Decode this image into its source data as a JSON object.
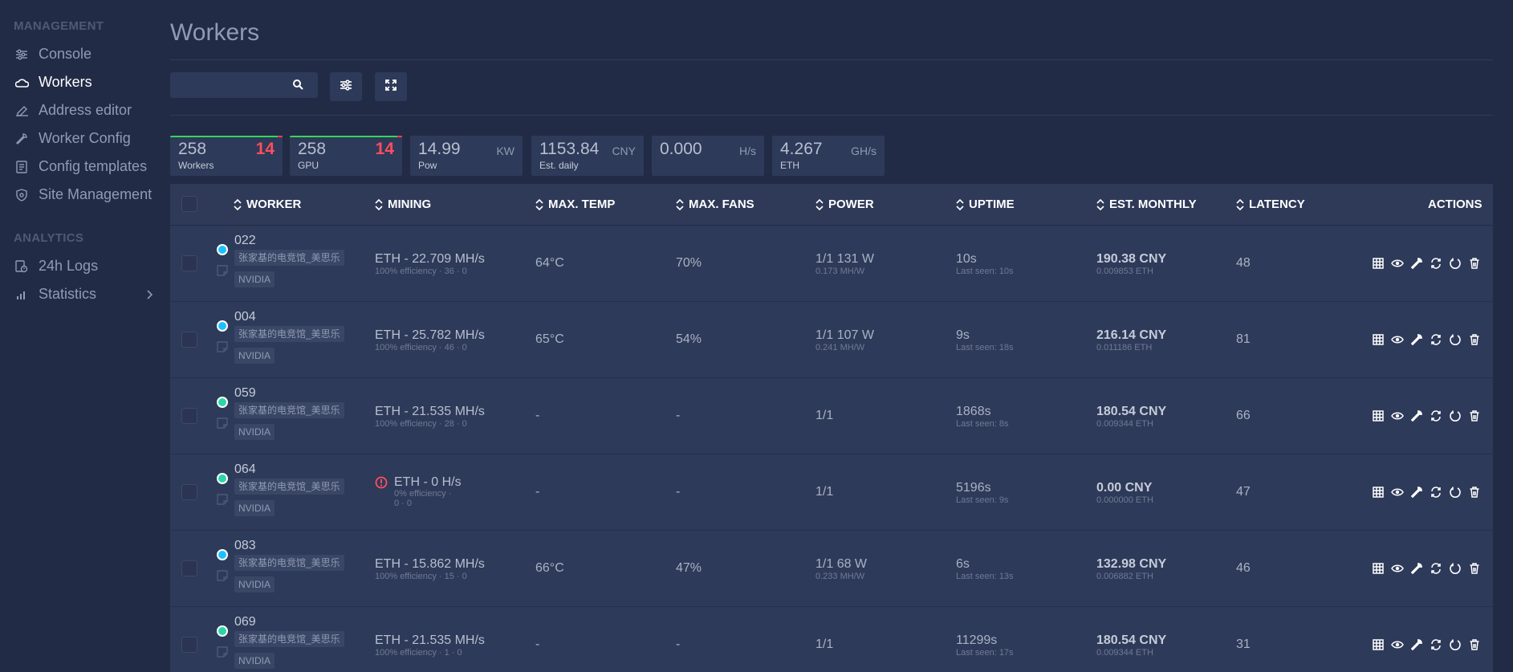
{
  "sidebar": {
    "management_title": "MANAGEMENT",
    "management_items": [
      {
        "label": "Console",
        "icon": "sliders-icon"
      },
      {
        "label": "Workers",
        "icon": "cloud-icon",
        "active": true
      },
      {
        "label": "Address editor",
        "icon": "edit-icon"
      },
      {
        "label": "Worker Config",
        "icon": "wrench-icon"
      },
      {
        "label": "Config templates",
        "icon": "document-icon"
      },
      {
        "label": "Site Management",
        "icon": "shield-icon"
      }
    ],
    "analytics_title": "ANALYTICS",
    "analytics_items": [
      {
        "label": "24h Logs",
        "icon": "log-icon"
      },
      {
        "label": "Statistics",
        "icon": "bar-chart-icon"
      }
    ]
  },
  "page": {
    "title": "Workers",
    "search_placeholder": ""
  },
  "stats": [
    {
      "value": "258",
      "label": "Workers",
      "bad": "14"
    },
    {
      "value": "258",
      "label": "GPU",
      "bad": "14"
    },
    {
      "value": "14.99",
      "label": "Pow",
      "unit": "KW"
    },
    {
      "value": "1153.84",
      "label": "Est. daily",
      "unit": "CNY"
    },
    {
      "value": "0.000",
      "label": "",
      "unit": "H/s"
    },
    {
      "value": "4.267",
      "label": "ETH",
      "unit": "GH/s"
    }
  ],
  "table": {
    "headers": {
      "worker": "WORKER",
      "mining": "MINING",
      "max_temp": "MAX. TEMP",
      "max_fans": "MAX. FANS",
      "power": "POWER",
      "uptime": "UPTIME",
      "est_monthly": "EST. MONTHLY",
      "latency": "LATENCY",
      "actions": "ACTIONS"
    },
    "rows": [
      {
        "name": "022",
        "location": "张家基的电竞馆_美思乐",
        "gpu": "NVIDIA",
        "status": "blue",
        "mining": "ETH - 22.709 MH/s",
        "mining_sub": "100% efficiency · 36 · 0",
        "temp": "64°C",
        "fans": "70%",
        "power": "1/1 131 W",
        "power_sub": "0.173 MH/W",
        "uptime": "10s",
        "last_seen": "Last seen: 10s",
        "est": "190.38 CNY",
        "est_sub": "0.009853 ETH",
        "latency": "48"
      },
      {
        "name": "004",
        "location": "张家基的电竞馆_美思乐",
        "gpu": "NVIDIA",
        "status": "blue",
        "mining": "ETH - 25.782 MH/s",
        "mining_sub": "100% efficiency · 46 · 0",
        "temp": "65°C",
        "fans": "54%",
        "power": "1/1 107 W",
        "power_sub": "0.241 MH/W",
        "uptime": "9s",
        "last_seen": "Last seen: 18s",
        "est": "216.14 CNY",
        "est_sub": "0.011186 ETH",
        "latency": "81"
      },
      {
        "name": "059",
        "location": "张家基的电竞馆_美思乐",
        "gpu": "NVIDIA",
        "status": "green",
        "mining": "ETH - 21.535 MH/s",
        "mining_sub": "100% efficiency · 28 · 0",
        "temp": "-",
        "fans": "-",
        "power": "1/1",
        "power_sub": "",
        "uptime": "1868s",
        "last_seen": "Last seen: 8s",
        "est": "180.54 CNY",
        "est_sub": "0.009344 ETH",
        "latency": "66"
      },
      {
        "name": "064",
        "location": "张家基的电竞馆_美思乐",
        "gpu": "NVIDIA",
        "status": "green",
        "alert": true,
        "mining": "ETH - 0 H/s",
        "mining_sub": "0% efficiency ·",
        "mining_sub2": "0 · 0",
        "temp": "-",
        "fans": "-",
        "power": "1/1",
        "power_sub": "",
        "uptime": "5196s",
        "last_seen": "Last seen: 9s",
        "est": "0.00 CNY",
        "est_sub": "0.000000 ETH",
        "latency": "47"
      },
      {
        "name": "083",
        "location": "张家基的电竞馆_美思乐",
        "gpu": "NVIDIA",
        "status": "blue",
        "mining": "ETH - 15.862 MH/s",
        "mining_sub": "100% efficiency · 15 · 0",
        "temp": "66°C",
        "fans": "47%",
        "power": "1/1 68 W",
        "power_sub": "0.233 MH/W",
        "uptime": "6s",
        "last_seen": "Last seen: 13s",
        "est": "132.98 CNY",
        "est_sub": "0.006882 ETH",
        "latency": "46"
      },
      {
        "name": "069",
        "location": "张家基的电竞馆_美思乐",
        "gpu": "NVIDIA",
        "status": "green",
        "mining": "ETH - 21.535 MH/s",
        "mining_sub": "100% efficiency · 1 · 0",
        "temp": "-",
        "fans": "-",
        "power": "1/1",
        "power_sub": "",
        "uptime": "11299s",
        "last_seen": "Last seen: 17s",
        "est": "180.54 CNY",
        "est_sub": "0.009344 ETH",
        "latency": "31"
      }
    ]
  },
  "colors": {
    "blue_status": "#1ec0ff",
    "green_status": "#2ad6a8",
    "alert": "#ff4d5e",
    "good_bar": "#36d65a"
  }
}
